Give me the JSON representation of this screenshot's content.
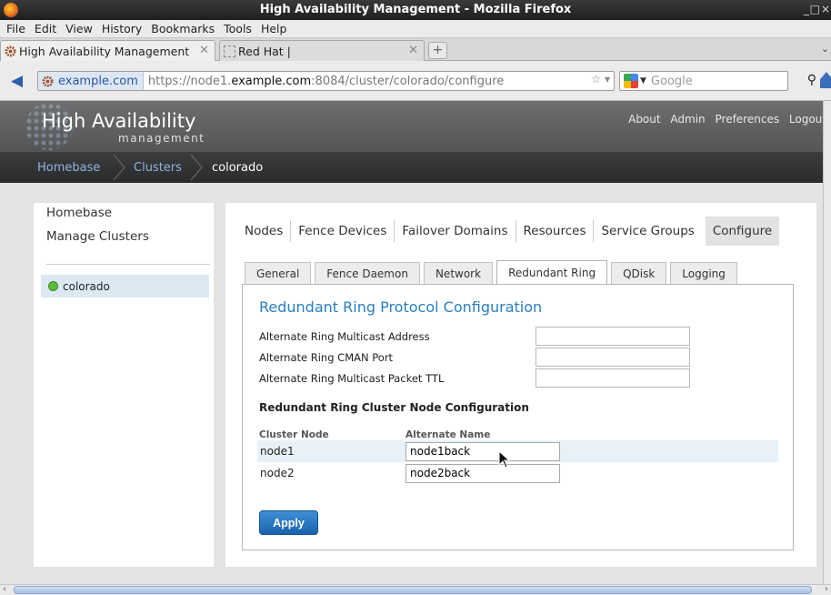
{
  "window": {
    "title": "High Availability Management - Mozilla Firefox",
    "min": "_",
    "max": "□",
    "close": "×"
  },
  "menu": [
    "File",
    "Edit",
    "View",
    "History",
    "Bookmarks",
    "Tools",
    "Help"
  ],
  "tabs": [
    {
      "label": "High Availability Management",
      "active": true
    },
    {
      "label": "Red Hat |",
      "active": false
    }
  ],
  "new_tab": "+",
  "nav": {
    "back": "◀",
    "identity": "example.com",
    "url_prefix": "https://node1.",
    "url_host": "example.com",
    "url_rest": ":8084/cluster/colorado/configure",
    "url_icons": "☆ ▾",
    "search_placeholder": "Google"
  },
  "app": {
    "logo_main": "High Availability",
    "logo_sub": "management",
    "top_links": [
      "About",
      "Admin",
      "Preferences",
      "Logout"
    ],
    "breadcrumb": [
      "Homebase",
      "Clusters",
      "colorado"
    ]
  },
  "sidebar": {
    "links": [
      "Homebase",
      "Manage Clusters"
    ],
    "clusters": [
      {
        "name": "colorado",
        "status_color": "#5cba3c"
      }
    ]
  },
  "topnav": [
    "Nodes",
    "Fence Devices",
    "Failover Domains",
    "Resources",
    "Service Groups",
    "Configure"
  ],
  "subtabs": [
    "General",
    "Fence Daemon",
    "Network",
    "Redundant Ring",
    "QDisk",
    "Logging"
  ],
  "active_subtab": "Redundant Ring",
  "form": {
    "title": "Redundant Ring Protocol Configuration",
    "fields": [
      {
        "label": "Alternate Ring Multicast Address",
        "value": ""
      },
      {
        "label": "Alternate Ring CMAN Port",
        "value": ""
      },
      {
        "label": "Alternate Ring Multicast Packet TTL",
        "value": ""
      }
    ],
    "node_section_title": "Redundant Ring Cluster Node Configuration",
    "col_node": "Cluster Node",
    "col_alt": "Alternate Name",
    "nodes": [
      {
        "name": "node1",
        "alt": "node1back"
      },
      {
        "name": "node2",
        "alt": "node2back"
      }
    ],
    "apply_label": "Apply"
  },
  "colors": {
    "accent": "#2a7fbf",
    "button": "#1a62ad",
    "header_bg": "#5f6062",
    "crumb_link": "#8fb4dd"
  }
}
